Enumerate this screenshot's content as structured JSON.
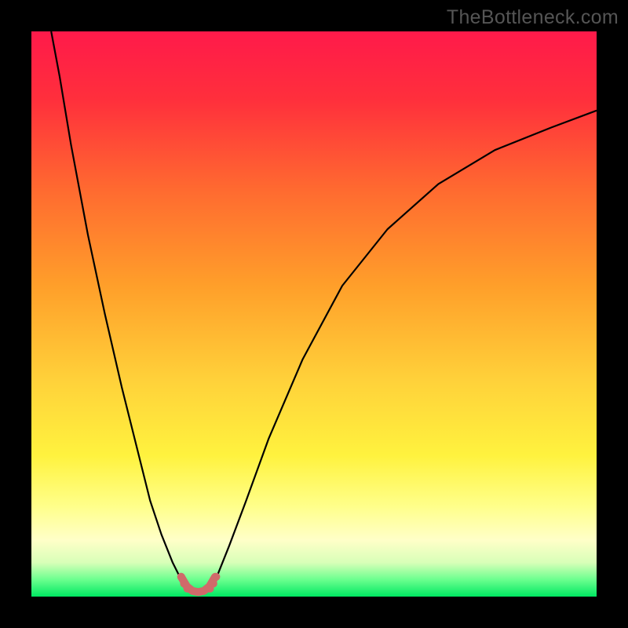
{
  "watermark": "TheBottleneck.com",
  "chart_data": {
    "type": "line",
    "title": "",
    "xlabel": "",
    "ylabel": "",
    "xlim": [
      0,
      100
    ],
    "ylim": [
      0,
      100
    ],
    "grid": false,
    "legend": false,
    "gradient_stops": [
      {
        "pos": 0.0,
        "color": "#ff1a4a"
      },
      {
        "pos": 0.12,
        "color": "#ff2f3c"
      },
      {
        "pos": 0.28,
        "color": "#ff6a30"
      },
      {
        "pos": 0.45,
        "color": "#ff9f2a"
      },
      {
        "pos": 0.62,
        "color": "#ffd23a"
      },
      {
        "pos": 0.75,
        "color": "#fff23e"
      },
      {
        "pos": 0.84,
        "color": "#ffff8a"
      },
      {
        "pos": 0.9,
        "color": "#ffffc8"
      },
      {
        "pos": 0.94,
        "color": "#d8ffb8"
      },
      {
        "pos": 0.97,
        "color": "#6bff8e"
      },
      {
        "pos": 1.0,
        "color": "#00e862"
      }
    ],
    "series": [
      {
        "name": "left-branch",
        "color": "#000000",
        "stroke_width": 2.2,
        "x": [
          3.5,
          5,
          7,
          10,
          13,
          16,
          19,
          21,
          23,
          25,
          26.5,
          28
        ],
        "y": [
          100,
          92,
          80,
          64,
          50,
          37,
          25,
          17,
          11,
          6,
          3,
          1
        ]
      },
      {
        "name": "right-branch",
        "color": "#000000",
        "stroke_width": 2.2,
        "x": [
          31,
          33,
          35,
          38,
          42,
          48,
          55,
          63,
          72,
          82,
          92,
          100
        ],
        "y": [
          1,
          4,
          9,
          17,
          28,
          42,
          55,
          65,
          73,
          79,
          83,
          86
        ]
      },
      {
        "name": "valley-floor",
        "color": "#cf6a6a",
        "stroke_width": 10,
        "cap": "round",
        "x": [
          26.5,
          27.5,
          28.5,
          29.5,
          30.5,
          31.5,
          32.5
        ],
        "y": [
          3.5,
          1.8,
          1.0,
          0.8,
          1.0,
          1.8,
          3.5
        ]
      }
    ],
    "markers": [
      {
        "x": 26.5,
        "y": 3.5,
        "r": 5,
        "color": "#cf6a6a"
      },
      {
        "x": 27.0,
        "y": 2.3,
        "r": 5,
        "color": "#cf6a6a"
      },
      {
        "x": 27.6,
        "y": 1.4,
        "r": 5,
        "color": "#cf6a6a"
      },
      {
        "x": 31.6,
        "y": 1.4,
        "r": 5,
        "color": "#cf6a6a"
      },
      {
        "x": 32.2,
        "y": 2.3,
        "r": 5,
        "color": "#cf6a6a"
      },
      {
        "x": 32.7,
        "y": 3.5,
        "r": 5,
        "color": "#cf6a6a"
      }
    ]
  }
}
